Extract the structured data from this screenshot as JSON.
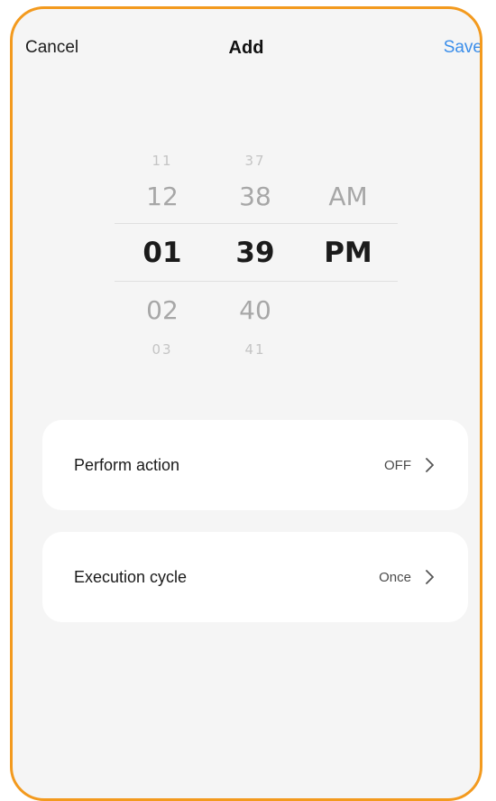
{
  "header": {
    "cancel_label": "Cancel",
    "title": "Add",
    "save_label": "Save"
  },
  "picker": {
    "hours": [
      "11",
      "12",
      "01",
      "02",
      "03"
    ],
    "minutes": [
      "37",
      "38",
      "39",
      "40",
      "41"
    ],
    "period": [
      "AM",
      "PM"
    ],
    "selected": {
      "hour": "01",
      "minute": "39",
      "period": "PM"
    }
  },
  "settings": [
    {
      "label": "Perform action",
      "value": "OFF"
    },
    {
      "label": "Execution cycle",
      "value": "Once"
    }
  ],
  "colors": {
    "accent": "#3b8eea",
    "frame": "#f39a1e",
    "background": "#f5f5f5"
  },
  "icons": {
    "row_chevron": "chevron-right-icon"
  }
}
